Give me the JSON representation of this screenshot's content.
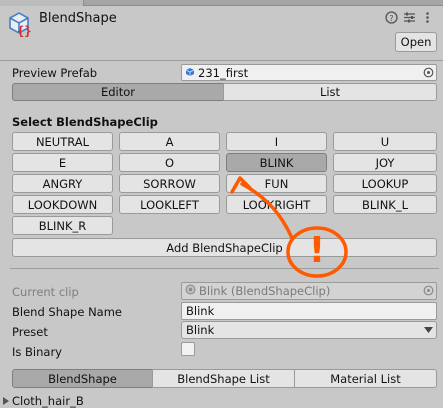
{
  "header": {
    "title": "BlendShape",
    "open_label": "Open",
    "icon_name": "blendshape-asset-icon",
    "icon_glyph": "{}"
  },
  "preview": {
    "label": "Preview Prefab",
    "value": "231_first"
  },
  "mode_tabs": [
    "Editor",
    "List"
  ],
  "clip_section": {
    "title": "Select BlendShapeClip",
    "clips": [
      "NEUTRAL",
      "A",
      "I",
      "U",
      "E",
      "O",
      "BLINK",
      "JOY",
      "ANGRY",
      "SORROW",
      "FUN",
      "LOOKUP",
      "LOOKDOWN",
      "LOOKLEFT",
      "LOOKRIGHT",
      "BLINK_L",
      "BLINK_R"
    ],
    "selected": "BLINK",
    "add_label": "Add BlendShapeClip"
  },
  "current": {
    "clip_label": "Current clip",
    "clip_value": "Blink (BlendShapeClip)",
    "name_label": "Blend Shape Name",
    "name_value": "Blink",
    "preset_label": "Preset",
    "preset_value": "Blink",
    "binary_label": "Is Binary"
  },
  "bottom_tabs": [
    "BlendShape",
    "BlendShape List",
    "Material List"
  ],
  "tree_item": "Cloth_hair_B",
  "annotation": {
    "mark": "!",
    "color": "#ff5a00"
  }
}
